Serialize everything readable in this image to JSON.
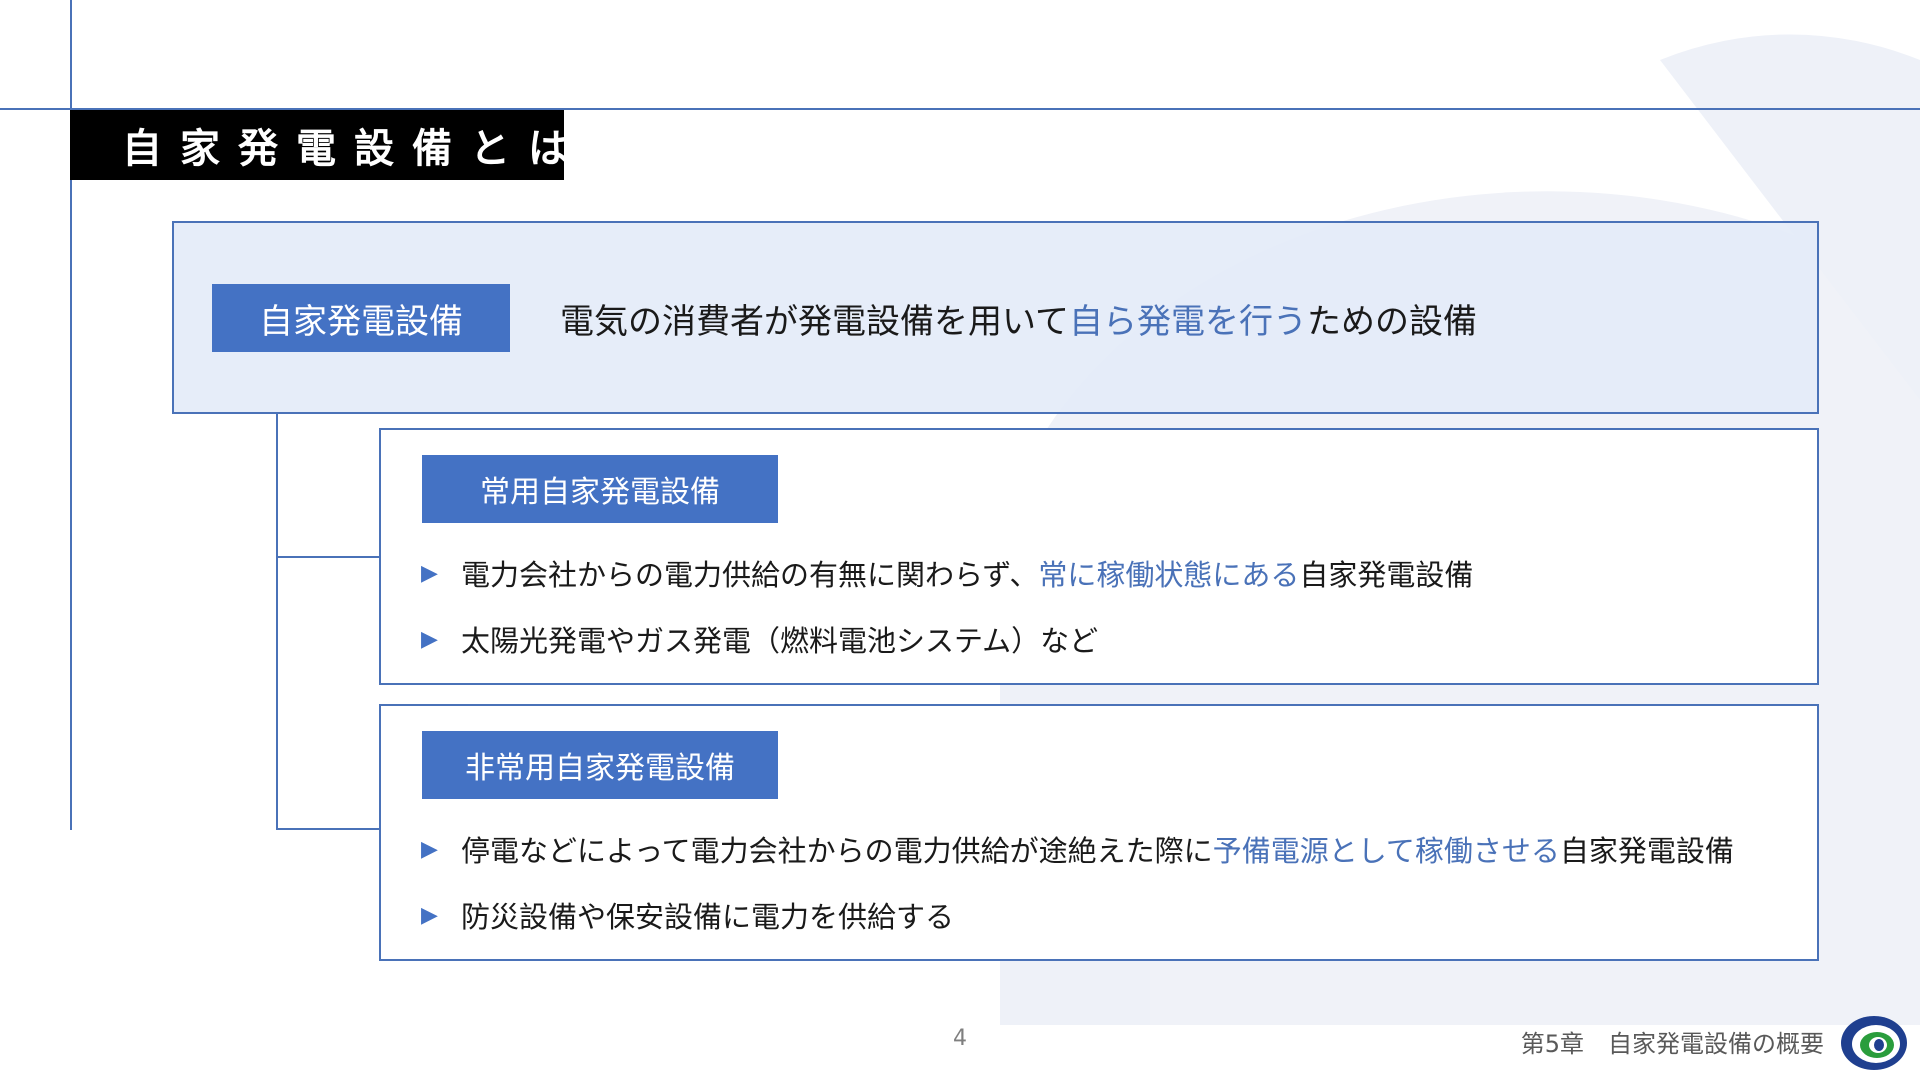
{
  "title": "自家発電設備とは",
  "definition": {
    "tag": "自家発電設備",
    "text_before": "電気の消費者が発電設備を用いて",
    "text_highlight": "自ら発電を行う",
    "text_after": "ための設備"
  },
  "categories": [
    {
      "tag": "常用自家発電設備",
      "bullets": [
        {
          "before": "電力会社からの電力供給の有無に関わらず、",
          "highlight": "常に稼働状態にある",
          "after": "自家発電設備"
        },
        {
          "before": "太陽光発電やガス発電（燃料電池システム）など",
          "highlight": "",
          "after": ""
        }
      ]
    },
    {
      "tag": "非常用自家発電設備",
      "bullets": [
        {
          "before": "停電などによって電力会社からの電力供給が途絶えた際に",
          "highlight": "予備電源として稼働させる",
          "after": "自家発電設備"
        },
        {
          "before": "防災設備や保安設備に電力を供給する",
          "highlight": "",
          "after": ""
        }
      ]
    }
  ],
  "bullet_icon": "play-triangle-icon",
  "footer": {
    "page_number": "4",
    "chapter": "第5章　自家発電設備の概要"
  },
  "colors": {
    "accent": "#4472c4",
    "line": "#4a72b8",
    "highlight_text": "#4a72b8",
    "title_bg": "#000000",
    "definition_bg": "#e4ecf8",
    "watermark": "#eef1f8"
  }
}
